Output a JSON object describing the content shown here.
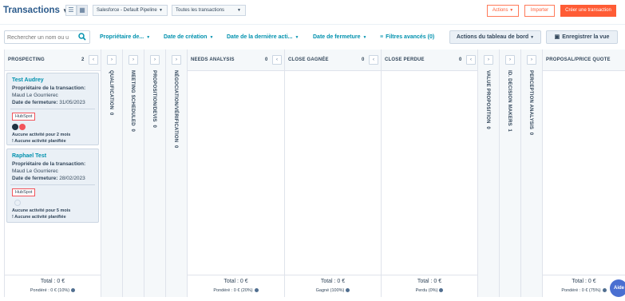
{
  "header": {
    "title": "Transactions",
    "pipeline": "Salesforce - Default Pipeline",
    "filter_select": "Toutes les transactions",
    "actions_label": "Actions",
    "import_label": "Importer",
    "create_label": "Créer une transaction"
  },
  "filters": {
    "search_placeholder": "Rechercher un nom ou u",
    "owner": "Propriétaire de...",
    "created": "Date de création",
    "last_activity": "Date de la dernière acti...",
    "close_date": "Date de fermeture",
    "advanced": "Filtres avancés (0)",
    "board_actions": "Actions du tableau de bord",
    "save_view": "Enregistrer la vue"
  },
  "columns": {
    "prospecting": {
      "name": "PROSPECTING",
      "count": "2",
      "total": "Total : 0 €",
      "weighted": "Pondéré : 0 € (10%)"
    },
    "qualification": {
      "name": "QUALIFICATION",
      "count": "0"
    },
    "meeting": {
      "name": "MEETING SCHEDULED",
      "count": "0"
    },
    "proposition": {
      "name": "PROPOSITION/DEVIS",
      "count": "0"
    },
    "negotiation": {
      "name": "NÉGOCIATION/VÉRIFICATION",
      "count": "0"
    },
    "needs": {
      "name": "NEEDS ANALYSIS",
      "count": "0",
      "total": "Total : 0 €",
      "weighted": "Pondéré : 0 € (20%)"
    },
    "won": {
      "name": "CLOSE GAGNÉE",
      "count": "0",
      "total": "Total : 0 €",
      "weighted": "Gagné (100%)"
    },
    "lost": {
      "name": "CLOSE PERDUE",
      "count": "0",
      "total": "Total : 0 €",
      "weighted": "Perdu (0%)"
    },
    "value": {
      "name": "VALUE PROPOSITION",
      "count": "0"
    },
    "decision": {
      "name": "ID. DECISION MAKERS",
      "count": "1"
    },
    "perception": {
      "name": "PERCEPTION ANALYSIS",
      "count": "0"
    },
    "proposal": {
      "name": "PROPOSAL/PRICE QUOTE",
      "total": "Total : 0 €",
      "weighted": "Pondéré : 0 € (75%)"
    }
  },
  "cards": [
    {
      "name": "Test Audrey",
      "owner_label": "Propriétaire de la transaction:",
      "owner": "Maud Le Gourrierec",
      "close_label": "Date de fermeture:",
      "close_date": "31/05/2023",
      "tag": "HubSpot",
      "activity": "Aucune activité pour 2 mois",
      "planned": "! Aucune activité planifiée"
    },
    {
      "name": "Raphael Test",
      "owner_label": "Propriétaire de la transaction:",
      "owner": "Maud Le Gourrierec",
      "close_label": "Date de fermeture:",
      "close_date": "28/02/2023",
      "tag": "HubSpot",
      "activity": "Aucune activité pour 5 mois",
      "planned": "! Aucune activité planifiée"
    }
  ],
  "help_label": "Aide",
  "colors": {
    "accent": "#ff5c35",
    "link": "#0091ae",
    "title": "#2c5b8c"
  },
  "icons": [
    "chevron-down-icon",
    "list-view-icon",
    "board-view-icon",
    "search-icon",
    "filter-icon",
    "save-icon",
    "chevron-left-icon",
    "chevron-right-icon",
    "info-icon"
  ]
}
